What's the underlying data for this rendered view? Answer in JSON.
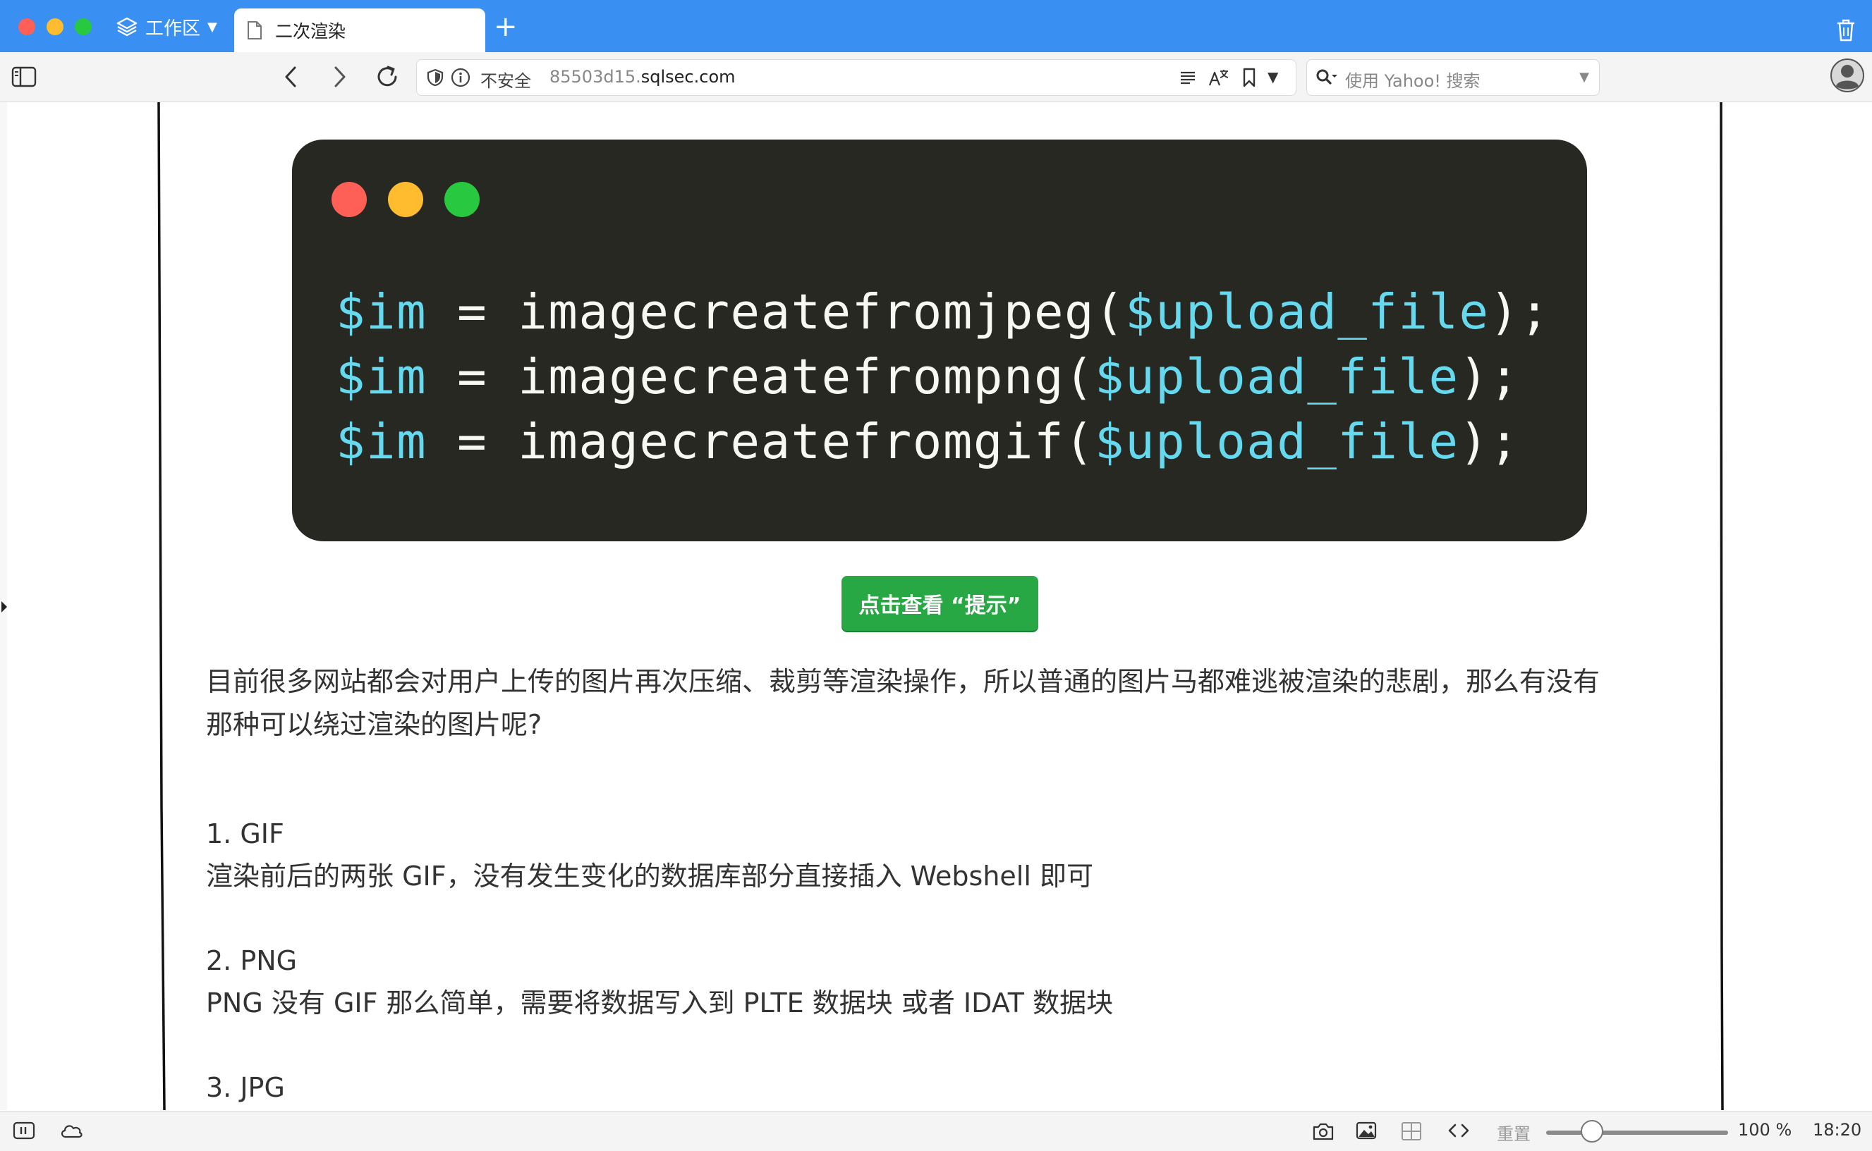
{
  "browser": {
    "workspace_label": "工作区",
    "tab_title": "二次渲染",
    "new_tab_symbol": "+"
  },
  "toolbar": {
    "security_label": "不安全",
    "url_subdomain": "85503d15.",
    "url_domain": "sqlsec.com",
    "search_placeholder": "使用 Yahoo! 搜索"
  },
  "page": {
    "code_lines": [
      {
        "var": "$im",
        "op": " = ",
        "func": "imagecreatefromjpeg(",
        "arg": "$upload_file",
        "end": ");"
      },
      {
        "var": "$im",
        "op": " = ",
        "func": "imagecreatefrompng(",
        "arg": "$upload_file",
        "end": ");"
      },
      {
        "var": "$im",
        "op": " = ",
        "func": "imagecreatefromgif(",
        "arg": "$upload_file",
        "end": ");"
      }
    ],
    "hint_button": "点击查看 “提示”",
    "intro_line1": "目前很多网站都会对用户上传的图片再次压缩、裁剪等渲染操作，所以普通的图片马都难逃被渲染的悲剧，那么有没有",
    "intro_line2": "那种可以绕过渲染的图片呢?",
    "gif_title": "1. GIF",
    "gif_desc": "渲染前后的两张 GIF，没有发生变化的数据库部分直接插入 Webshell 即可",
    "png_title": "2. PNG",
    "png_desc": "PNG 没有 GIF 那么简单，需要将数据写入到 PLTE 数据块 或者 IDAT 数据块",
    "jpg_title": "3. JPG"
  },
  "statusbar": {
    "reset_label": "重置",
    "zoom_level": "100 %",
    "zoom_fraction": 0.25,
    "clock": "18:20"
  },
  "colors": {
    "tabbar": "#3a8ff2",
    "code_bg": "#272822",
    "code_var": "#66d9ef",
    "code_text": "#f8f8f2",
    "hint_button": "#28a745"
  },
  "icons": [
    "layers-icon",
    "chevron-down-icon",
    "document-icon",
    "plus-icon",
    "trash-icon",
    "sidebar-icon",
    "back-icon",
    "forward-icon",
    "reload-icon",
    "shield-icon",
    "info-icon",
    "reader-icon",
    "translate-icon",
    "bookmark-icon",
    "search-icon",
    "profile-icon",
    "panel-icon",
    "cloud-icon",
    "camera-icon",
    "image-icon",
    "tile-icon",
    "code-icon"
  ]
}
